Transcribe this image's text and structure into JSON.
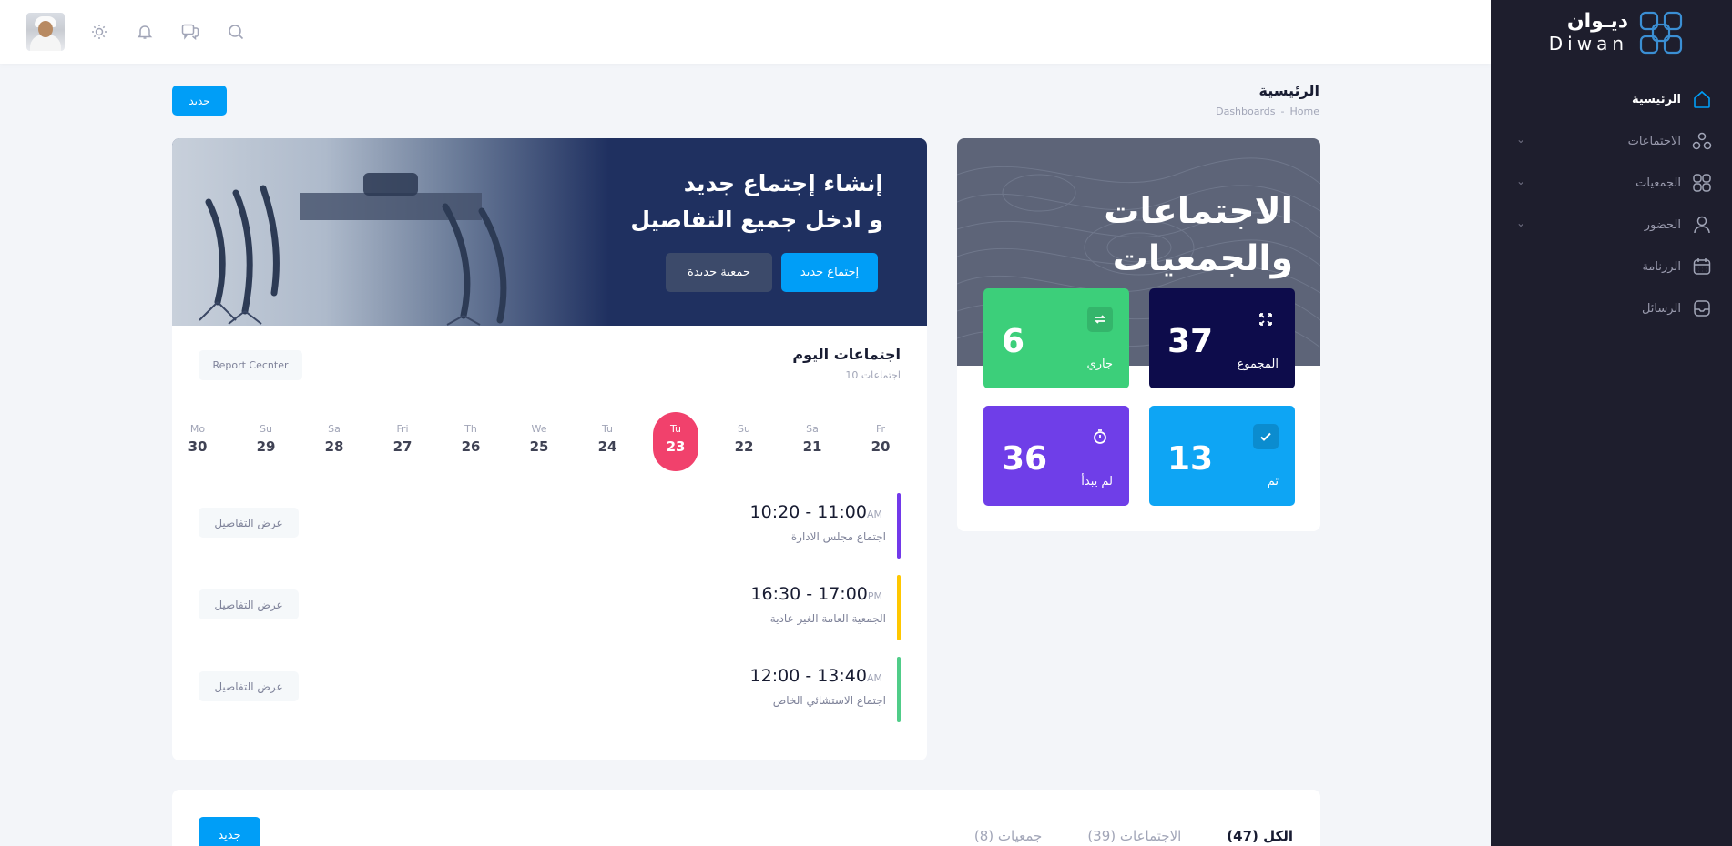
{
  "brand": {
    "name_ar": "ديـوان",
    "name_en": "Diwan"
  },
  "sidebar": {
    "items": [
      {
        "label": "الرئيسية",
        "icon": "home-icon",
        "active": true,
        "has_children": false
      },
      {
        "label": "الاجتماعات",
        "icon": "meetings-icon",
        "active": false,
        "has_children": true
      },
      {
        "label": "الجمعيات",
        "icon": "associations-icon",
        "active": false,
        "has_children": true
      },
      {
        "label": "الحضور",
        "icon": "attendance-user-icon",
        "active": false,
        "has_children": true
      },
      {
        "label": "الرزنامة",
        "icon": "calendar-icon",
        "active": false,
        "has_children": false
      },
      {
        "label": "الرسائل",
        "icon": "messages-icon",
        "active": false,
        "has_children": false
      }
    ]
  },
  "topbar": {
    "icons": [
      "search-icon",
      "chat-icon",
      "notification-bell-icon",
      "theme-sun-icon"
    ],
    "avatar": "user-avatar"
  },
  "page": {
    "title": "الرئيسية",
    "breadcrumb": [
      "Home",
      "Dashboards"
    ],
    "new_button": "جديد"
  },
  "stats": {
    "title_line1": "الاجتماعات",
    "title_line2": "والجمعيات",
    "tiles": [
      {
        "label": "المجموع",
        "value": "37",
        "icon": "expand-icon",
        "color": "#0d0c4b"
      },
      {
        "label": "جاري",
        "value": "6",
        "icon": "repeat-icon",
        "color": "#3ccf7a"
      },
      {
        "label": "تم",
        "value": "13",
        "icon": "check-icon",
        "color": "#0ea5f4"
      },
      {
        "label": "لم يبدأ",
        "value": "36",
        "icon": "timer-icon",
        "color": "#6f3ee8"
      }
    ]
  },
  "banner": {
    "line1": "إنشاء إجتماع جديد",
    "line2": "و ادخل جميع التفاصيل",
    "btn_meeting": "إجتماع جديد",
    "btn_association": "جمعية جديدة"
  },
  "today": {
    "title": "اجتماعات اليوم",
    "subtitle": "10 اجتماعات",
    "report_button": "Report Cecnter",
    "days": [
      {
        "name": "Fr",
        "num": "20",
        "active": false
      },
      {
        "name": "Sa",
        "num": "21",
        "active": false
      },
      {
        "name": "Su",
        "num": "22",
        "active": false
      },
      {
        "name": "Tu",
        "num": "23",
        "active": true
      },
      {
        "name": "Tu",
        "num": "24",
        "active": false
      },
      {
        "name": "We",
        "num": "25",
        "active": false
      },
      {
        "name": "Th",
        "num": "26",
        "active": false
      },
      {
        "name": "Fri",
        "num": "27",
        "active": false
      },
      {
        "name": "Sa",
        "num": "28",
        "active": false
      },
      {
        "name": "Su",
        "num": "29",
        "active": false
      },
      {
        "name": "Mo",
        "num": "30",
        "active": false
      }
    ],
    "meetings": [
      {
        "time": "10:20 - 11:00",
        "ampm": "AM",
        "name": "اجتماع مجلس الادارة",
        "color": "#7239ea",
        "button": "عرض التفاصيل"
      },
      {
        "time": "16:30 - 17:00",
        "ampm": "PM",
        "name": "الجمعية العامة الغير عادية",
        "color": "#ffc700",
        "button": "عرض التفاصيل"
      },
      {
        "time": "12:00 - 13:40",
        "ampm": "AM",
        "name": "اجتماع الاستشائي الخاص",
        "color": "#50cd89",
        "button": "عرض التفاصيل"
      }
    ]
  },
  "list": {
    "tabs": [
      {
        "label": "الكل (47)",
        "active": true
      },
      {
        "label": "الاجتماعات (39)",
        "active": false
      },
      {
        "label": "جمعيات (8)",
        "active": false
      }
    ],
    "new_button": "جديد"
  }
}
